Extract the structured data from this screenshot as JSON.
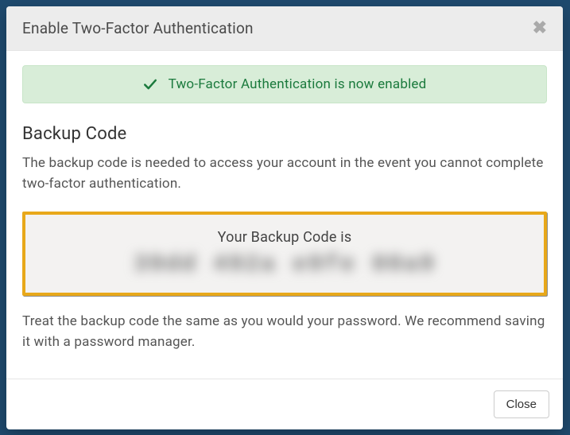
{
  "modal": {
    "title": "Enable Two-Factor Authentication",
    "alert": "Two-Factor Authentication is now enabled",
    "section_title": "Backup Code",
    "intro_text": "The backup code is needed to access your account in the event you cannot complete two-factor authentication.",
    "code_label": "Your Backup Code is",
    "code_value": "39dd 492a e9fe 00a9",
    "post_text": "Treat the backup code the same as you would your password. We recommend saving it with a password manager.",
    "close_button": "Close"
  }
}
